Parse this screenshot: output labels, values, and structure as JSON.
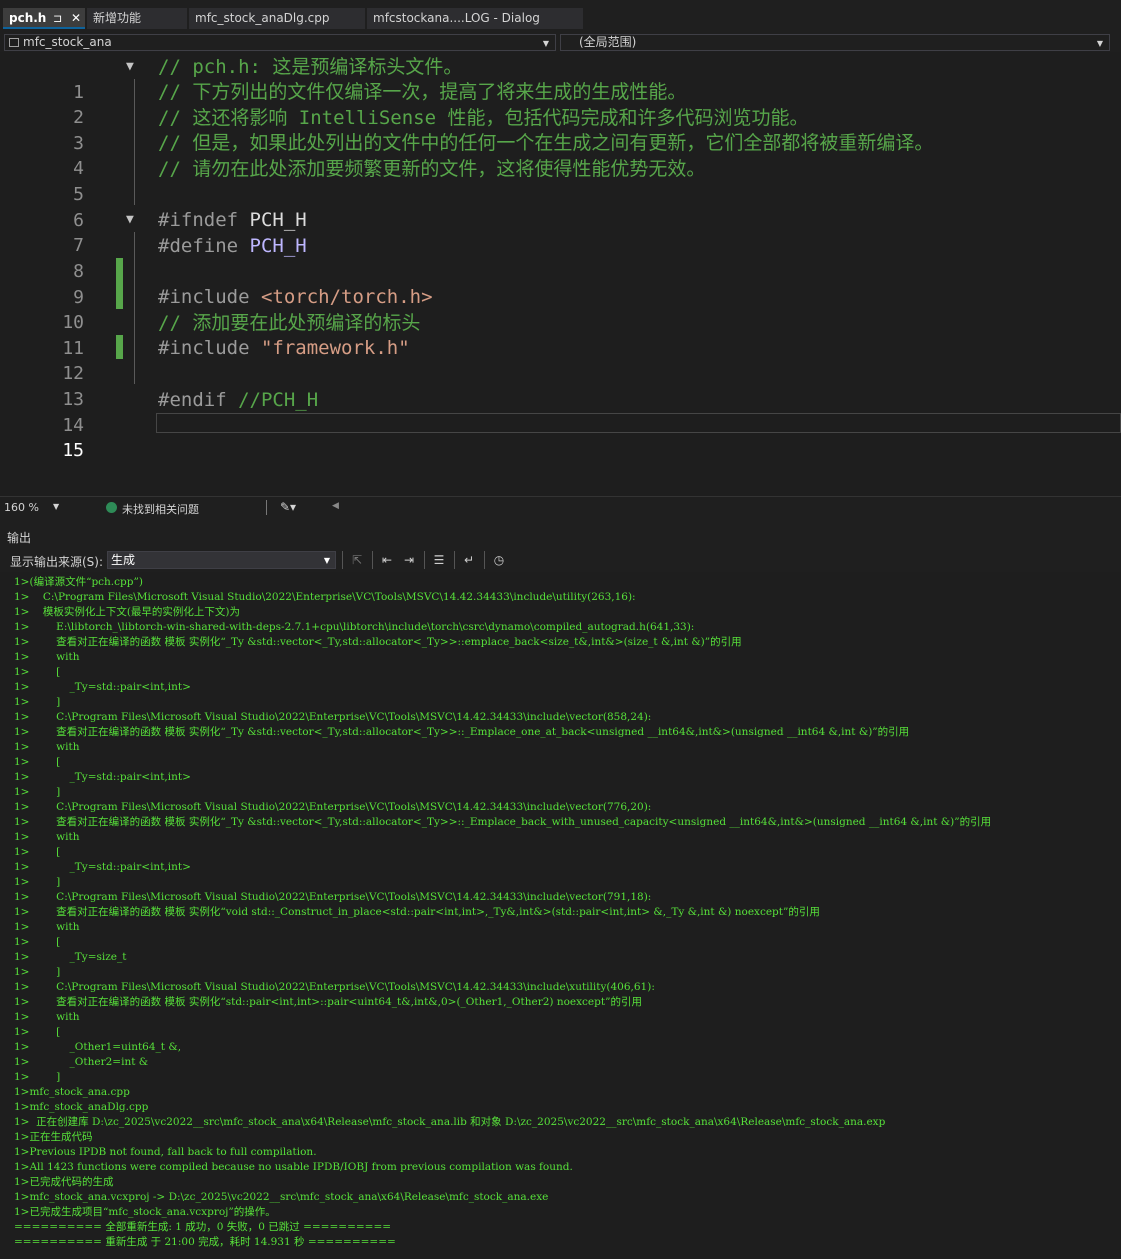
{
  "tabs": [
    {
      "label": "pch.h",
      "active": true
    },
    {
      "label": "新增功能"
    },
    {
      "label": "mfc_stock_anaDlg.cpp"
    },
    {
      "label": "mfcstockana....LOG - Dialog"
    }
  ],
  "tab_icons": {
    "pin": "⊐",
    "close": "✕"
  },
  "nav": {
    "project": "mfc_stock_ana",
    "scope": "(全局范围)"
  },
  "editor": {
    "lines": [
      {
        "n": "1",
        "text": "// pch.h: 这是预编译标头文件。"
      },
      {
        "n": "2",
        "text": "// 下方列出的文件仅编译一次，提高了将来生成的生成性能。"
      },
      {
        "n": "3",
        "text": "// 这还将影响 IntelliSense 性能，包括代码完成和许多代码浏览功能。"
      },
      {
        "n": "4",
        "text": "// 但是，如果此处列出的文件中的任何一个在生成之间有更新，它们全部都将被重新编译。"
      },
      {
        "n": "5",
        "text": "// 请勿在此处添加要频繁更新的文件，这将使得性能优势无效。"
      },
      {
        "n": "6",
        "text": ""
      },
      {
        "n": "7",
        "directive": "#ifndef",
        "macro": "PCH_H"
      },
      {
        "n": "8",
        "directive": "#define",
        "macro": "PCH_H"
      },
      {
        "n": "9",
        "text": ""
      },
      {
        "n": "10",
        "directive": "#include",
        "string": "<torch/torch.h>"
      },
      {
        "n": "11",
        "text": "// 添加要在此处预编译的标头"
      },
      {
        "n": "12",
        "directive": "#include",
        "string": "\"framework.h\""
      },
      {
        "n": "13",
        "text": ""
      },
      {
        "n": "14",
        "directive": "#endif",
        "comment": "//PCH_H"
      },
      {
        "n": "15",
        "text": ""
      }
    ]
  },
  "status": {
    "zoom": "160 %",
    "issues": "未找到相关问题"
  },
  "output_panel": {
    "title": "输出",
    "source_label": "显示输出来源(S):",
    "source_value": "生成",
    "lines": [
      "1>(编译源文件“pch.cpp”)",
      "1>    C:\\Program Files\\Microsoft Visual Studio\\2022\\Enterprise\\VC\\Tools\\MSVC\\14.42.34433\\include\\utility(263,16):",
      "1>    模板实例化上下文(最早的实例化上下文)为",
      "1>        E:\\libtorch_\\libtorch-win-shared-with-deps-2.7.1+cpu\\libtorch\\include\\torch\\csrc\\dynamo\\compiled_autograd.h(641,33):",
      "1>        查看对正在编译的函数 模板 实例化“_Ty &std::vector<_Ty,std::allocator<_Ty>>::emplace_back<size_t&,int&>(size_t &,int &)”的引用",
      "1>        with",
      "1>        [",
      "1>            _Ty=std::pair<int,int>",
      "1>        ]",
      "1>        C:\\Program Files\\Microsoft Visual Studio\\2022\\Enterprise\\VC\\Tools\\MSVC\\14.42.34433\\include\\vector(858,24):",
      "1>        查看对正在编译的函数 模板 实例化“_Ty &std::vector<_Ty,std::allocator<_Ty>>::_Emplace_one_at_back<unsigned __int64&,int&>(unsigned __int64 &,int &)”的引用",
      "1>        with",
      "1>        [",
      "1>            _Ty=std::pair<int,int>",
      "1>        ]",
      "1>        C:\\Program Files\\Microsoft Visual Studio\\2022\\Enterprise\\VC\\Tools\\MSVC\\14.42.34433\\include\\vector(776,20):",
      "1>        查看对正在编译的函数 模板 实例化“_Ty &std::vector<_Ty,std::allocator<_Ty>>::_Emplace_back_with_unused_capacity<unsigned __int64&,int&>(unsigned __int64 &,int &)”的引用",
      "1>        with",
      "1>        [",
      "1>            _Ty=std::pair<int,int>",
      "1>        ]",
      "1>        C:\\Program Files\\Microsoft Visual Studio\\2022\\Enterprise\\VC\\Tools\\MSVC\\14.42.34433\\include\\vector(791,18):",
      "1>        查看对正在编译的函数 模板 实例化“void std::_Construct_in_place<std::pair<int,int>,_Ty&,int&>(std::pair<int,int> &,_Ty &,int &) noexcept”的引用",
      "1>        with",
      "1>        [",
      "1>            _Ty=size_t",
      "1>        ]",
      "1>        C:\\Program Files\\Microsoft Visual Studio\\2022\\Enterprise\\VC\\Tools\\MSVC\\14.42.34433\\include\\xutility(406,61):",
      "1>        查看对正在编译的函数 模板 实例化“std::pair<int,int>::pair<uint64_t&,int&,0>(_Other1,_Other2) noexcept”的引用",
      "1>        with",
      "1>        [",
      "1>            _Other1=uint64_t &,",
      "1>            _Other2=int &",
      "1>        ]",
      "1>mfc_stock_ana.cpp",
      "1>mfc_stock_anaDlg.cpp",
      "1>  正在创建库 D:\\zc_2025\\vc2022__src\\mfc_stock_ana\\x64\\Release\\mfc_stock_ana.lib 和对象 D:\\zc_2025\\vc2022__src\\mfc_stock_ana\\x64\\Release\\mfc_stock_ana.exp",
      "1>正在生成代码",
      "1>Previous IPDB not found, fall back to full compilation.",
      "1>All 1423 functions were compiled because no usable IPDB/IOBJ from previous compilation was found.",
      "1>已完成代码的生成",
      "1>mfc_stock_ana.vcxproj -> D:\\zc_2025\\vc2022__src\\mfc_stock_ana\\x64\\Release\\mfc_stock_ana.exe",
      "1>已完成生成项目“mfc_stock_ana.vcxproj”的操作。",
      "========== 全部重新生成: 1 成功，0 失败，0 已跳过 ==========",
      "========== 重新生成 于 21:00 完成，耗时 14.931 秒 =========="
    ]
  },
  "colors": {
    "comment": "#57a64a",
    "macro": "#beb7ff",
    "string": "#d69d85",
    "output_text": "#57e03a",
    "change_bar": "#57a64a"
  }
}
